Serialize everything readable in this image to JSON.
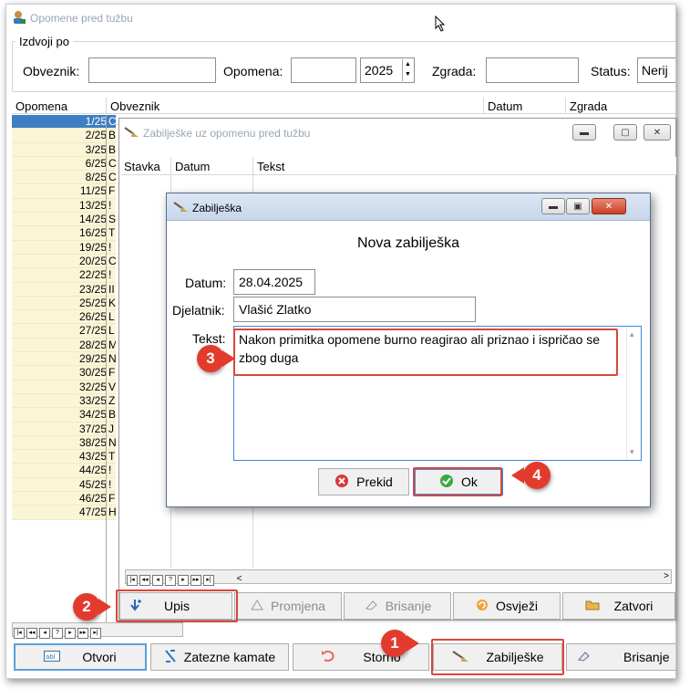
{
  "main": {
    "title": "Opomene pred tužbu",
    "filter": {
      "legend": "Izdvoji po",
      "obveznik_label": "Obveznik:",
      "obveznik_value": "",
      "opomena_label": "Opomena:",
      "opomena_value": "",
      "year": "2025",
      "zgrada_label": "Zgrada:",
      "zgrada_value": "",
      "status_label": "Status:",
      "status_value": "Nerij"
    },
    "columns": [
      "Opomena",
      "Obveznik",
      "Datum",
      "Zgrada"
    ],
    "rows": [
      {
        "opomena": "1/25",
        "obv": "C"
      },
      {
        "opomena": "2/25",
        "obv": "B"
      },
      {
        "opomena": "3/25",
        "obv": "B"
      },
      {
        "opomena": "6/25",
        "obv": "C"
      },
      {
        "opomena": "8/25",
        "obv": "C"
      },
      {
        "opomena": "11/25",
        "obv": "F"
      },
      {
        "opomena": "13/25",
        "obv": "!"
      },
      {
        "opomena": "14/25",
        "obv": "S"
      },
      {
        "opomena": "16/25",
        "obv": "T"
      },
      {
        "opomena": "19/25",
        "obv": "!"
      },
      {
        "opomena": "20/25",
        "obv": "C"
      },
      {
        "opomena": "22/25",
        "obv": "!"
      },
      {
        "opomena": "23/25",
        "obv": "II"
      },
      {
        "opomena": "25/25",
        "obv": "K"
      },
      {
        "opomena": "26/25",
        "obv": "L"
      },
      {
        "opomena": "27/25",
        "obv": "L"
      },
      {
        "opomena": "28/25",
        "obv": "M"
      },
      {
        "opomena": "29/25",
        "obv": "N"
      },
      {
        "opomena": "30/25",
        "obv": "F"
      },
      {
        "opomena": "32/25",
        "obv": "V"
      },
      {
        "opomena": "33/25",
        "obv": "Z"
      },
      {
        "opomena": "34/25",
        "obv": "B"
      },
      {
        "opomena": "37/25",
        "obv": "J"
      },
      {
        "opomena": "38/25",
        "obv": "N"
      },
      {
        "opomena": "43/25",
        "obv": "T"
      },
      {
        "opomena": "44/25",
        "obv": "!"
      },
      {
        "opomena": "45/25",
        "obv": "!"
      },
      {
        "opomena": "46/25",
        "obv": "F"
      },
      {
        "opomena": "47/25",
        "obv": "H"
      }
    ],
    "buttons": {
      "otvori": "Otvori",
      "zatezne": "Zatezne kamate",
      "storno": "Storno",
      "zabiljeske": "Zabilješke",
      "brisanje": "Brisanje"
    }
  },
  "notes_window": {
    "title": "Zabilješke uz opomenu pred tužbu",
    "columns": [
      "Stavka",
      "Datum",
      "Tekst"
    ],
    "buttons": {
      "upis": "Upis",
      "promjena": "Promjena",
      "brisanje": "Brisanje",
      "osvjezi": "Osvježi",
      "zatvori": "Zatvori"
    }
  },
  "dialog": {
    "title": "Zabilješka",
    "heading": "Nova zabilješka",
    "datum_label": "Datum:",
    "datum_value": "28.04.2025",
    "djelatnik_label": "Djelatnik:",
    "djelatnik_value": "Vlašić Zlatko",
    "tekst_label": "Tekst:",
    "tekst_value": "Nakon primitka opomene burno reagirao ali priznao i ispričao se zbog duga",
    "prekid": "Prekid",
    "ok": "Ok"
  },
  "callouts": [
    "1",
    "2",
    "3",
    "4"
  ],
  "colors": {
    "callout": "#e23b2e",
    "selected_row": "#3d7fc1",
    "row_yellow": "#fbf5d8",
    "ok_green": "#3aa845",
    "prekid_red": "#d8383a"
  }
}
